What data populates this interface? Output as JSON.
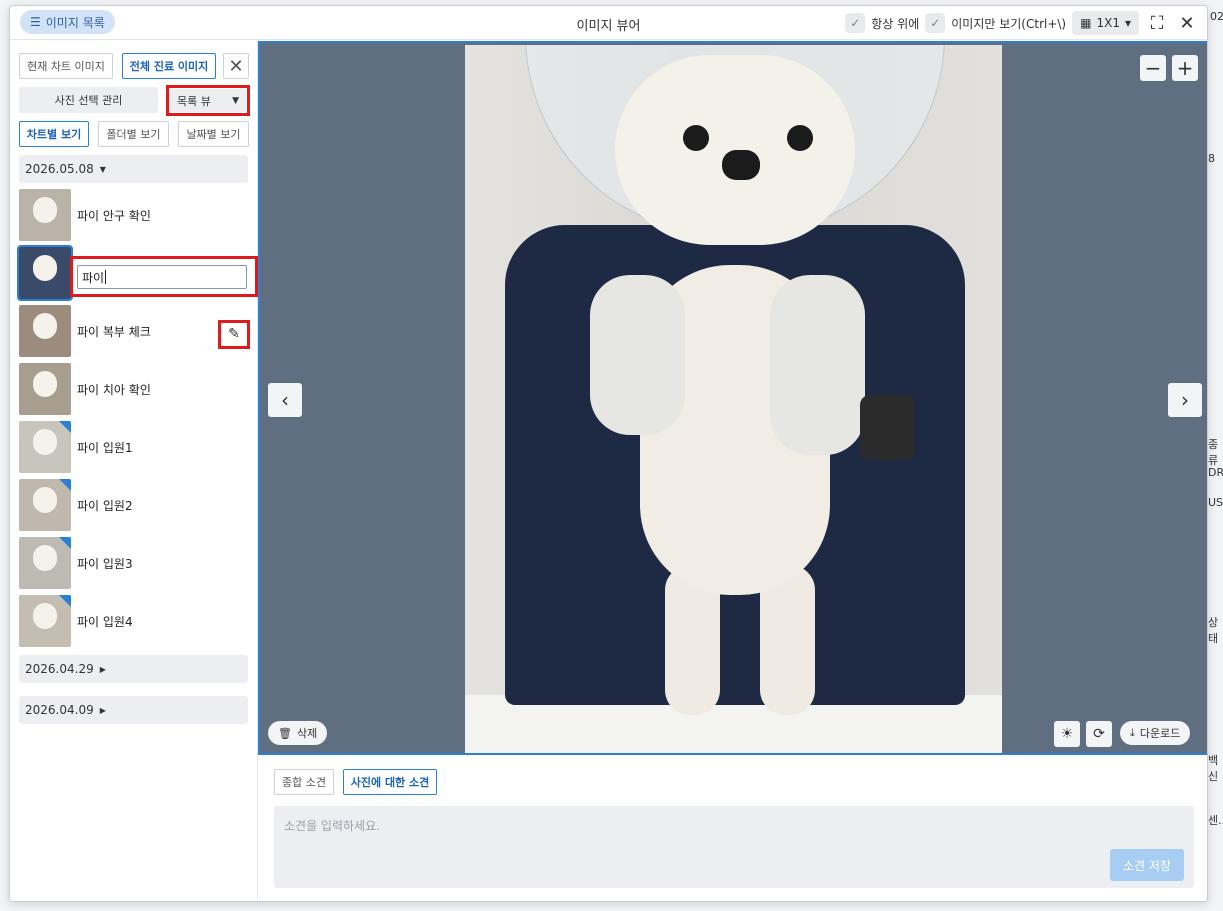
{
  "titlebar": {
    "image_list_label": "이미지 목록",
    "title": "이미지 뷰어",
    "always_on_top_label": "항상 위에",
    "image_only_label": "이미지만 보기(Ctrl+\\)",
    "layout_label": "1X1"
  },
  "sidebar": {
    "current_chart_images": "현재 차트 이미지",
    "all_visit_images": "전체 진료 이미지",
    "photo_select_manage": "사진 선택 관리",
    "view_mode": "목록 뷰",
    "tabs": [
      "차트별 보기",
      "폴더별 보기",
      "날짜별 보기"
    ],
    "groups": [
      {
        "date": "2026.05.08",
        "expanded": true
      },
      {
        "date": "2026.04.29",
        "expanded": false
      },
      {
        "date": "2026.04.09",
        "expanded": false
      }
    ],
    "items": [
      {
        "label": "파이 안구 확인"
      },
      {
        "label": "",
        "editing_value": "파이"
      },
      {
        "label": "파이 복부 체크"
      },
      {
        "label": "파이 치아 확인"
      },
      {
        "label": "파이 입원1"
      },
      {
        "label": "파이 입원2"
      },
      {
        "label": "파이 입원3"
      },
      {
        "label": "파이 입원4"
      }
    ]
  },
  "viewer": {
    "delete_label": "삭제",
    "download_label": "다운로드"
  },
  "comment": {
    "tabs": [
      "종합 소견",
      "사진에 대한 소견"
    ],
    "placeholder": "소견을 입력하세요.",
    "save_label": "소견 저장"
  },
  "background": {
    "fragments": [
      "02",
      "8",
      "종류",
      "DR",
      "US",
      "상태",
      "백신",
      "센..."
    ]
  },
  "colors": {
    "accent": "#2b7fd4",
    "highlight_red": "#e01b1b",
    "viewer_bg": "#5f6e80"
  }
}
